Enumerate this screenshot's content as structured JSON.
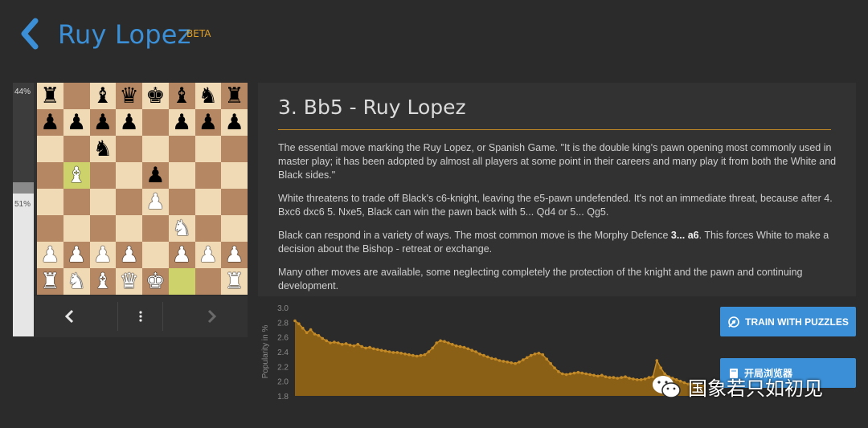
{
  "header": {
    "title": "Ruy Lopez",
    "badge": "BETA"
  },
  "eval": {
    "white_top": "44%",
    "bottom": "51%",
    "black_fraction": 0.44
  },
  "board": {
    "highlight_squares": [
      "b5",
      "f1"
    ],
    "rows": [
      [
        "r",
        "",
        "b",
        "q",
        "k",
        "b",
        "n",
        "r"
      ],
      [
        "p",
        "p",
        "p",
        "p",
        "",
        "p",
        "p",
        "p"
      ],
      [
        "",
        "",
        "n",
        "",
        "",
        "",
        "",
        ""
      ],
      [
        "",
        "B",
        "",
        "",
        "p",
        "",
        "",
        ""
      ],
      [
        "",
        "",
        "",
        "",
        "P",
        "",
        "",
        ""
      ],
      [
        "",
        "",
        "",
        "",
        "",
        "N",
        "",
        ""
      ],
      [
        "P",
        "P",
        "P",
        "P",
        "",
        "P",
        "P",
        "P"
      ],
      [
        "R",
        "N",
        "B",
        "Q",
        "K",
        "",
        "",
        "R"
      ]
    ]
  },
  "board_nav": {
    "prev_icon": "chevron-left-icon",
    "menu_icon": "vertical-dots-icon",
    "next_icon": "chevron-right-icon"
  },
  "content": {
    "title": "3. Bb5 - Ruy Lopez",
    "p1": "The essential move marking the Ruy Lopez, or Spanish Game. \"It is the double king's pawn opening most commonly used in master play; it has been adopted by almost all players at some point in their careers and many play it from both the White and Black sides.\"",
    "p2": "White threatens to trade off Black's c6-knight, leaving the e5-pawn undefended. It's not an immediate threat, because after 4. Bxc6 dxc6 5. Nxe5, Black can win the pawn back with 5... Qd4 or 5... Qg5.",
    "p3_pre": "Black can respond in a variety of ways. The most common move is the Morphy Defence ",
    "p3_bold": "3... a6",
    "p3_post": ". This forces White to make a decision about the Bishop - retreat or exchange.",
    "p4": "Many other moves are available, some neglecting completely the protection of the knight and the pawn and continuing development."
  },
  "chart_data": {
    "type": "area",
    "ylabel": "Popularity in %",
    "ylim": [
      1.8,
      3.0
    ],
    "yticks": [
      "3.0",
      "2.8",
      "2.6",
      "2.4",
      "2.2",
      "2.0",
      "1.8"
    ],
    "values": [
      2.82,
      2.78,
      2.72,
      2.66,
      2.7,
      2.64,
      2.62,
      2.58,
      2.55,
      2.52,
      2.53,
      2.52,
      2.5,
      2.51,
      2.49,
      2.48,
      2.5,
      2.47,
      2.45,
      2.46,
      2.44,
      2.43,
      2.42,
      2.41,
      2.4,
      2.39,
      2.39,
      2.38,
      2.37,
      2.36,
      2.35,
      2.34,
      2.35,
      2.36,
      2.4,
      2.45,
      2.52,
      2.55,
      2.54,
      2.52,
      2.5,
      2.48,
      2.47,
      2.46,
      2.44,
      2.42,
      2.4,
      2.37,
      2.35,
      2.33,
      2.31,
      2.3,
      2.28,
      2.27,
      2.26,
      2.25,
      2.24,
      2.26,
      2.29,
      2.32,
      2.35,
      2.37,
      2.38,
      2.36,
      2.3,
      2.24,
      2.18,
      2.13,
      2.1,
      2.09,
      2.1,
      2.11,
      2.12,
      2.11,
      2.1,
      2.09,
      2.08,
      2.07,
      2.08,
      2.06,
      2.05,
      2.05,
      2.04,
      2.05,
      2.06,
      2.04,
      2.03,
      2.02,
      2.02,
      2.03,
      2.05,
      2.06,
      2.28,
      2.18,
      2.1,
      2.06,
      2.04,
      2.02,
      2.0,
      1.98,
      1.96,
      1.96,
      1.95,
      1.94,
      1.94
    ],
    "fill": "#8a5f16",
    "line": "#c48a26"
  },
  "buttons": {
    "train": "TRAIN WITH PUZZLES",
    "explorer": "开局浏览器"
  },
  "watermark": {
    "text": "国象若只如初见"
  },
  "colors": {
    "accent": "#3b8fd6",
    "beta": "#e0a028",
    "rule": "#c48a26"
  }
}
